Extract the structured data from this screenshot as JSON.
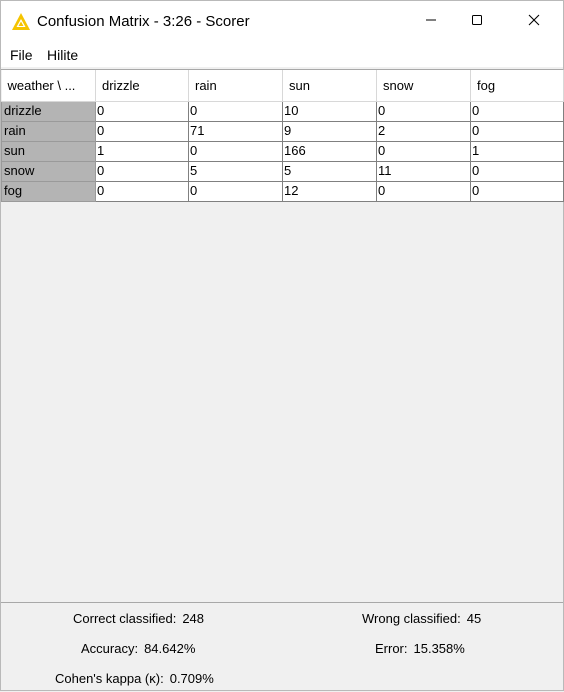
{
  "window": {
    "title": "Confusion Matrix - 3:26 - Scorer"
  },
  "menu": {
    "file": "File",
    "hilite": "Hilite"
  },
  "table": {
    "corner_header": "weather \\ ...",
    "columns": [
      "drizzle",
      "rain",
      "sun",
      "snow",
      "fog"
    ],
    "rows": [
      {
        "label": "drizzle",
        "cells": [
          "0",
          "0",
          "10",
          "0",
          "0"
        ]
      },
      {
        "label": "rain",
        "cells": [
          "0",
          "71",
          "9",
          "2",
          "0"
        ]
      },
      {
        "label": "sun",
        "cells": [
          "1",
          "0",
          "166",
          "0",
          "1"
        ]
      },
      {
        "label": "snow",
        "cells": [
          "0",
          "5",
          "5",
          "11",
          "0"
        ]
      },
      {
        "label": "fog",
        "cells": [
          "0",
          "0",
          "12",
          "0",
          "0"
        ]
      }
    ]
  },
  "stats": {
    "correct_label": "Correct classified:",
    "correct_value": "248",
    "wrong_label": "Wrong classified:",
    "wrong_value": "45",
    "accuracy_label": "Accuracy:",
    "accuracy_value": "84.642%",
    "error_label": "Error:",
    "error_value": "15.358%",
    "kappa_label": "Cohen's kappa (κ):",
    "kappa_value": "0.709%"
  },
  "colors": {
    "title_icon": "#f5c400",
    "row_header_bg": "#b4b4b4",
    "window_bg": "#f0f0f0"
  },
  "icons": {
    "app": "knime-triangle-icon",
    "minimize": "minimize-icon",
    "maximize": "maximize-icon",
    "close": "close-icon"
  }
}
